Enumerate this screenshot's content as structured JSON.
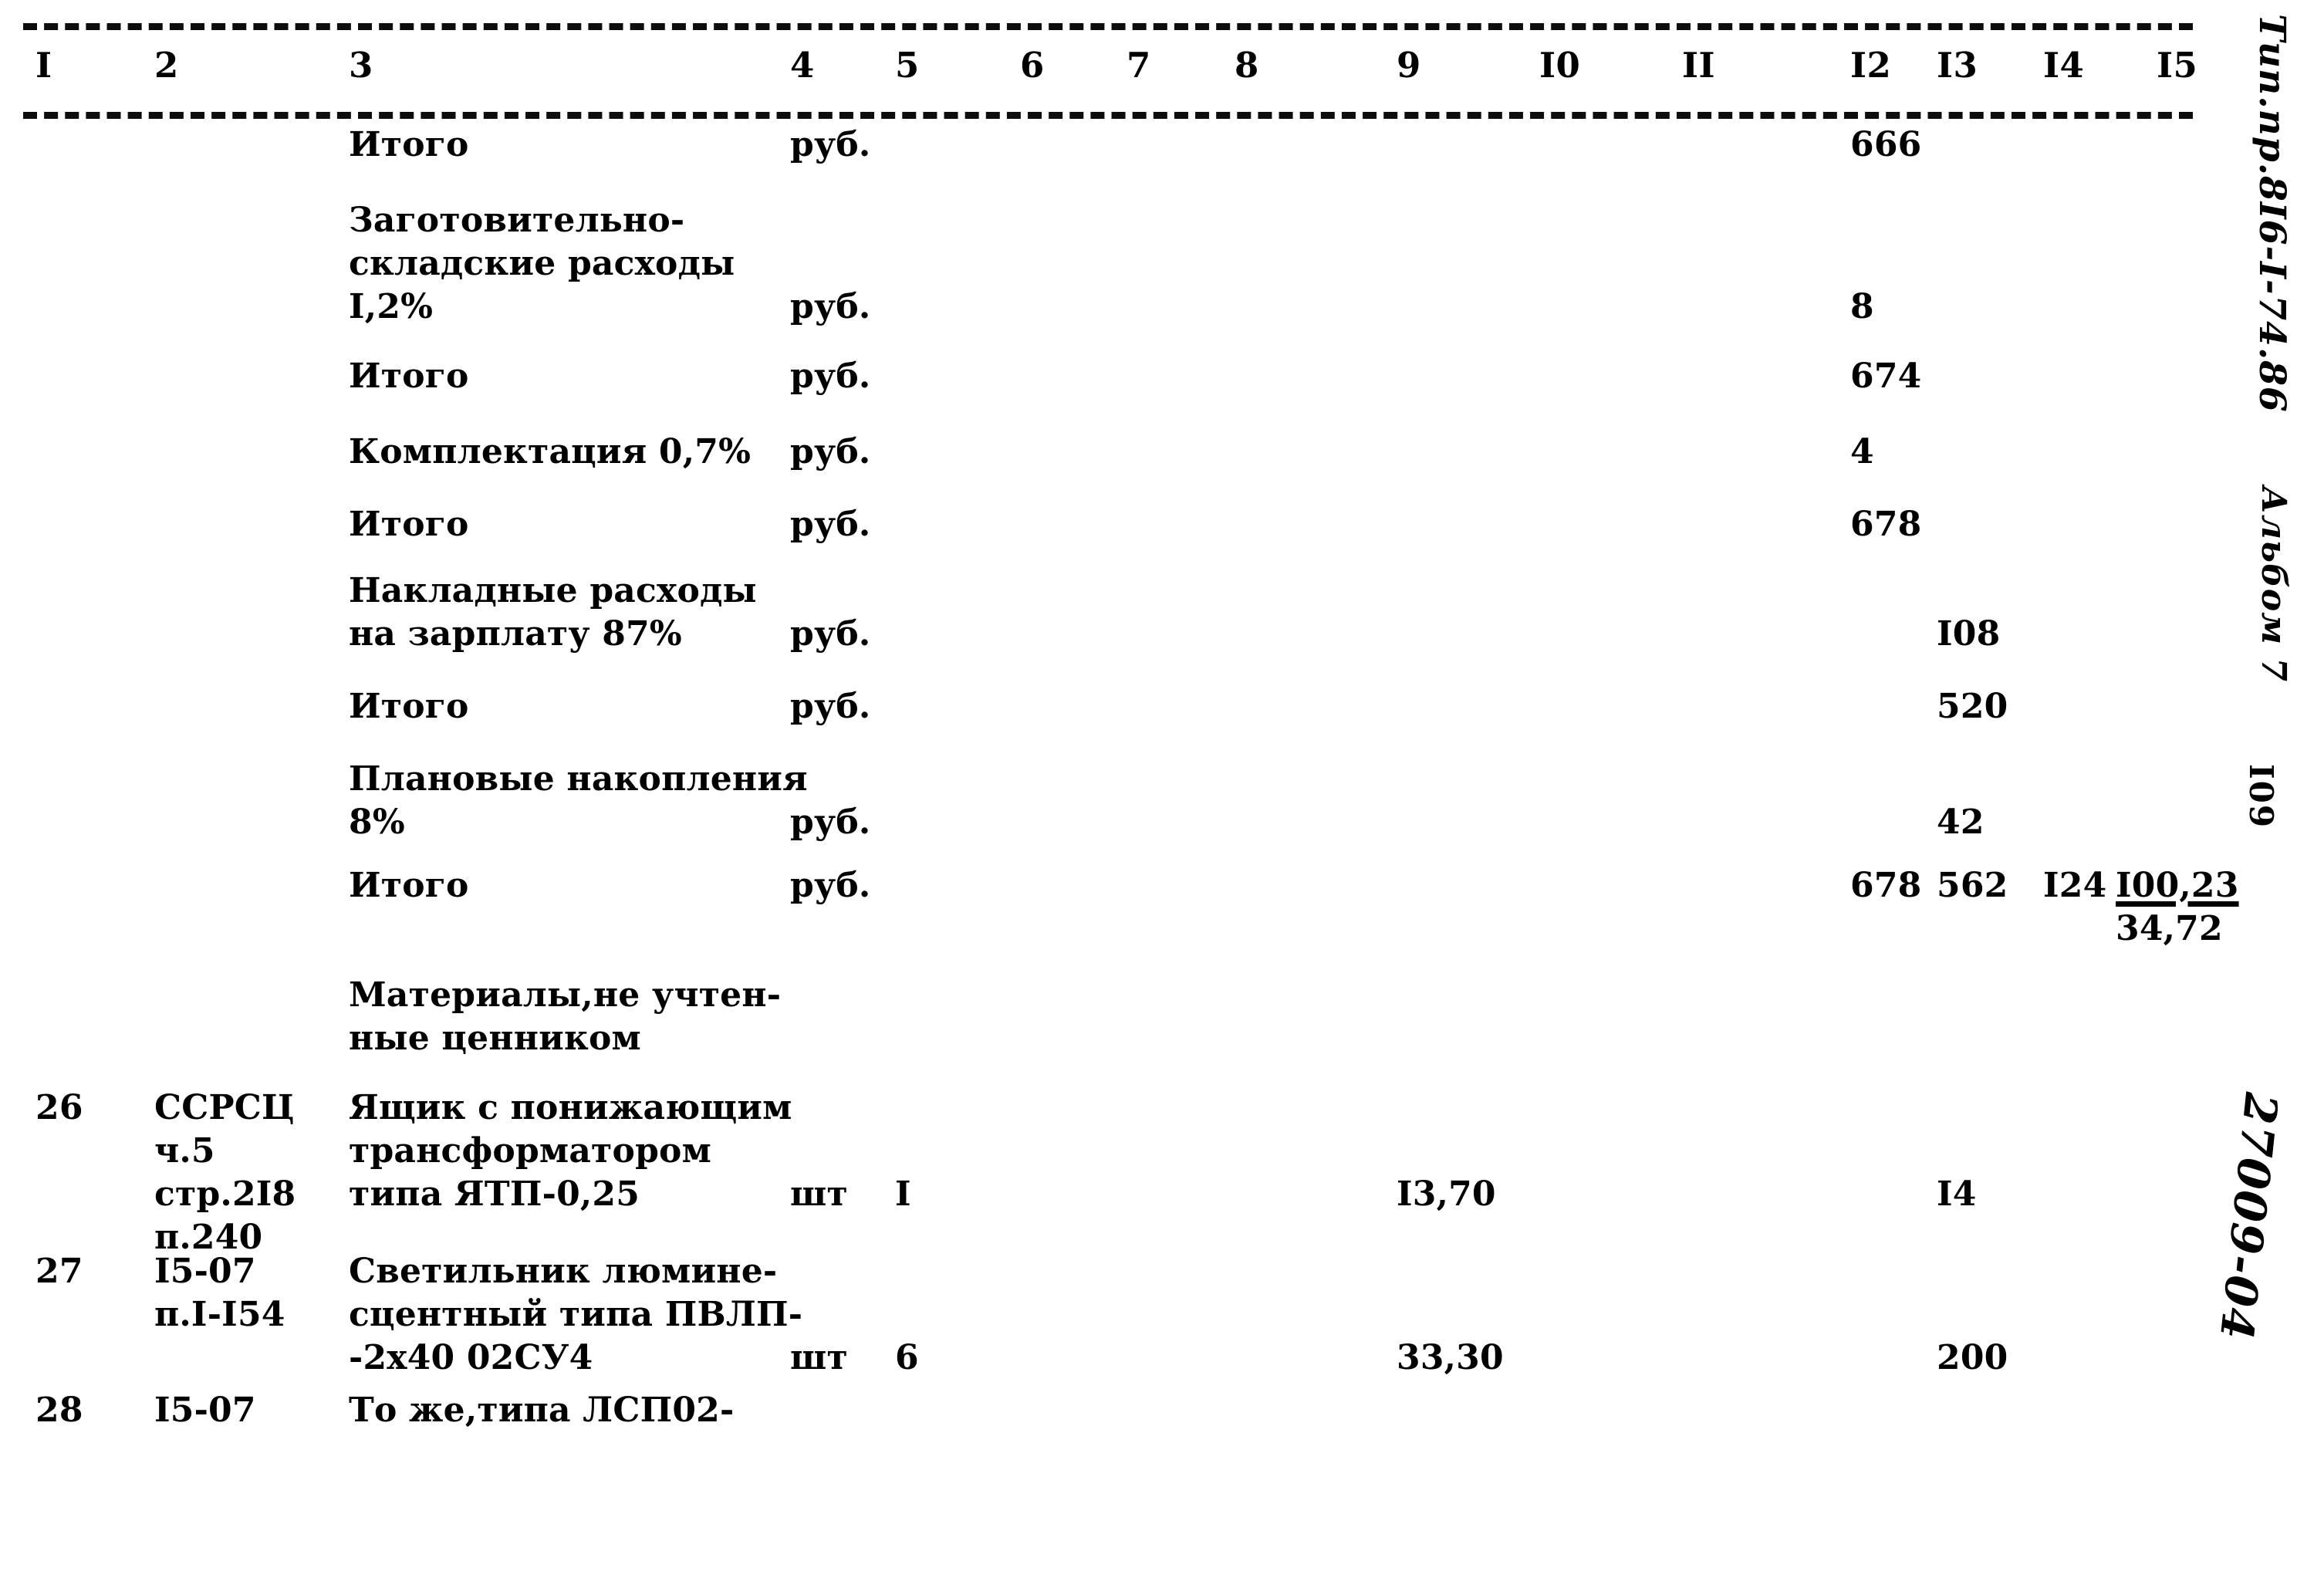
{
  "document": {
    "column_headers": [
      "I",
      "2",
      "3",
      "4",
      "5",
      "6",
      "7",
      "8",
      "9",
      "I0",
      "II",
      "I2",
      "I3",
      "I4",
      "I5"
    ],
    "margin_notes": {
      "doc_code": "Тип.пр.8I6-I-74.86",
      "album": "Альбом 7",
      "page_number": "I09",
      "archive_number": "27009-04"
    },
    "rows": [
      {
        "pos": "",
        "code": "",
        "name": "Итого",
        "unit": "руб.",
        "qty": "",
        "price": "",
        "c12": "666",
        "c13": "",
        "c14": "",
        "c15": ""
      },
      {
        "pos": "",
        "code": "",
        "name": "Заготовительно-\nскладские расходы\nI,2%",
        "unit": "руб.",
        "qty": "",
        "price": "",
        "c12": "8",
        "c13": "",
        "c14": "",
        "c15": ""
      },
      {
        "pos": "",
        "code": "",
        "name": "Итого",
        "unit": "руб.",
        "qty": "",
        "price": "",
        "c12": "674",
        "c13": "",
        "c14": "",
        "c15": ""
      },
      {
        "pos": "",
        "code": "",
        "name": "Комплектация 0,7%",
        "unit": "руб.",
        "qty": "",
        "price": "",
        "c12": "4",
        "c13": "",
        "c14": "",
        "c15": ""
      },
      {
        "pos": "",
        "code": "",
        "name": "Итого",
        "unit": "руб.",
        "qty": "",
        "price": "",
        "c12": "678",
        "c13": "",
        "c14": "",
        "c15": ""
      },
      {
        "pos": "",
        "code": "",
        "name": "Накладные расходы\nна зарплату 87%",
        "unit": "руб.",
        "qty": "",
        "price": "",
        "c12": "",
        "c13": "I08",
        "c14": "",
        "c15": ""
      },
      {
        "pos": "",
        "code": "",
        "name": "Итого",
        "unit": "руб.",
        "qty": "",
        "price": "",
        "c12": "",
        "c13": "520",
        "c14": "",
        "c15": ""
      },
      {
        "pos": "",
        "code": "",
        "name": "Плановые накопления\n8%",
        "unit": "руб.",
        "qty": "",
        "price": "",
        "c12": "",
        "c13": "42",
        "c14": "",
        "c15": ""
      },
      {
        "pos": "",
        "code": "",
        "name": "Итого",
        "unit": "руб.",
        "qty": "",
        "price": "",
        "c12": "678",
        "c13": "562",
        "c14": "I24",
        "c15": "I00,23",
        "c15_second": "34,72"
      },
      {
        "pos": "",
        "code": "",
        "name": "Материалы,не учтен-\nные ценником",
        "unit": "",
        "qty": "",
        "price": "",
        "c12": "",
        "c13": "",
        "c14": "",
        "c15": ""
      },
      {
        "pos": "26",
        "code": "ССРСЦ\nч.5\nстр.2I8\nп.240",
        "name": "Ящик с понижающим\nтрансформатором\nтипа ЯТП-0,25",
        "unit": "шт",
        "qty": "I",
        "price": "I3,70",
        "c12": "",
        "c13": "I4",
        "c14": "",
        "c15": ""
      },
      {
        "pos": "27",
        "code": "I5-07\nп.I-I54",
        "name": "Светильник люмине-\nсцентный типа ПВЛП-\n-2х40 02СУ4",
        "unit": "шт",
        "qty": "6",
        "price": "33,30",
        "c12": "",
        "c13": "200",
        "c14": "",
        "c15": ""
      },
      {
        "pos": "28",
        "code": "I5-07",
        "name": "То же,типа ЛСП02-",
        "unit": "",
        "qty": "",
        "price": "",
        "c12": "",
        "c13": "",
        "c14": "",
        "c15": ""
      }
    ]
  }
}
